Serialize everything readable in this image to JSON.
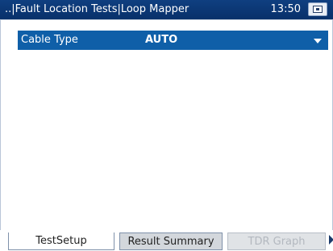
{
  "titlebar": {
    "title": "..|Fault Location Tests|Loop Mapper",
    "time": "13:50"
  },
  "setting": {
    "label": "Cable Type",
    "value": "AUTO"
  },
  "tabs": [
    {
      "label": "TestSetup",
      "state": "active"
    },
    {
      "label": "Result Summary",
      "state": "normal"
    },
    {
      "label": "TDR Graph",
      "state": "disabled"
    }
  ],
  "colors": {
    "titlebar": "#0a3674",
    "selected_row": "#0f5fa8"
  }
}
